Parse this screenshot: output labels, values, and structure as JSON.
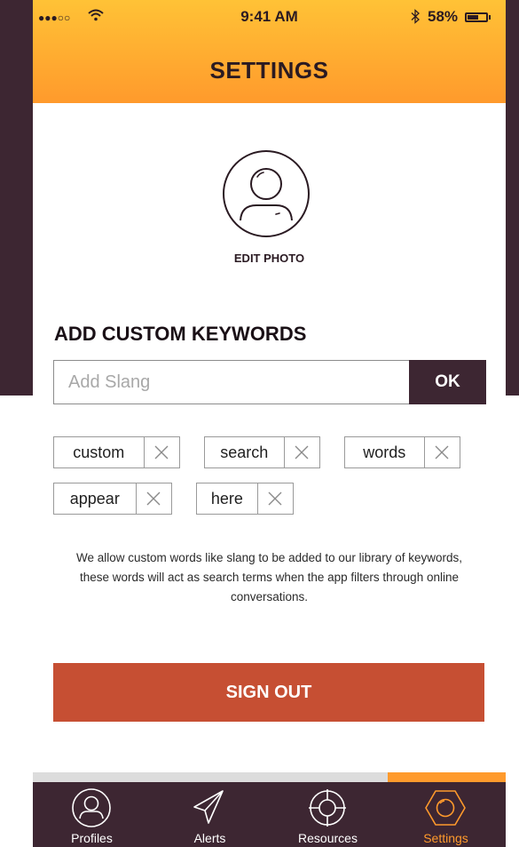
{
  "status": {
    "time": "9:41 AM",
    "battery": "58%",
    "signal_icon": "signal-dots-icon",
    "wifi_icon": "wifi-icon",
    "bluetooth_icon": "bluetooth-icon"
  },
  "header": {
    "title": "SETTINGS"
  },
  "profile": {
    "edit_photo_label": "EDIT PHOTO",
    "avatar_icon": "user-avatar-icon"
  },
  "keywords": {
    "title": "ADD CUSTOM KEYWORDS",
    "input_value": "",
    "input_placeholder": "Add Slang",
    "ok_label": "OK",
    "chips": [
      "custom",
      "search",
      "words",
      "appear",
      "here"
    ],
    "description": "We allow custom words like slang to be added to our library of keywords, these words will act as search terms when the app filters through online conversations."
  },
  "signout_label": "SIGN OUT",
  "tabs": [
    {
      "label": "Profiles",
      "icon": "profile-icon",
      "active": false
    },
    {
      "label": "Alerts",
      "icon": "paper-plane-icon",
      "active": false
    },
    {
      "label": "Resources",
      "icon": "crosshair-icon",
      "active": false
    },
    {
      "label": "Settings",
      "icon": "hexagon-icon",
      "active": true
    }
  ],
  "colors": {
    "header_top": "#ffc236",
    "header_bottom": "#ff9a2c",
    "dark": "#3d2632",
    "signout": "#c64f33",
    "accent": "#ff9a2c"
  }
}
